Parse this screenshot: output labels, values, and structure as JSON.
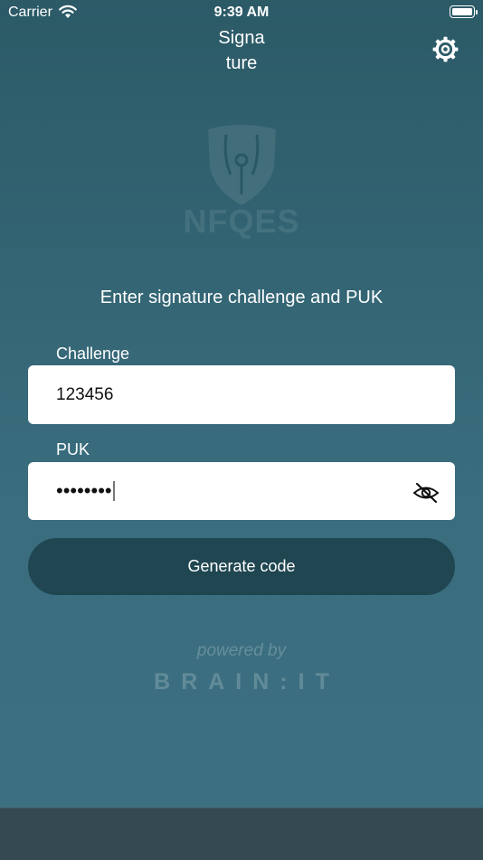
{
  "status_bar": {
    "carrier": "Carrier",
    "time": "9:39 AM"
  },
  "nav": {
    "title_line1": "Signa",
    "title_line2": "ture",
    "settings_icon": "gear-icon"
  },
  "logo": {
    "text": "NFQES",
    "icon": "shield-pen-nib-icon"
  },
  "prompt": "Enter signature challenge and PUK",
  "form": {
    "challenge_label": "Challenge",
    "challenge_value": "123456",
    "puk_label": "PUK",
    "puk_masked": "••••••••",
    "visibility_icon": "eye-slash-icon"
  },
  "generate_button": "Generate code",
  "footer": {
    "powered_by": "powered by",
    "brand": "BRAIN:IT"
  },
  "colors": {
    "background_top": "#2c5a67",
    "background_bottom": "#3c6f80",
    "button": "#1f4651",
    "tab_bar": "#344a50"
  }
}
